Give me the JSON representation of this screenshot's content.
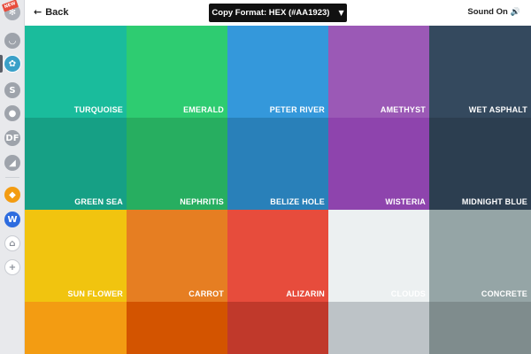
{
  "topbar": {
    "back_label": "Back",
    "back_arrow": "←",
    "copy_format_label": "Copy Format: HEX (#AA1923)",
    "copy_format_caret": "▼",
    "sound_label": "Sound On",
    "sound_icon": "🔊"
  },
  "rail": {
    "badge_text": "NEW",
    "items": [
      {
        "icon": "snowflake-icon",
        "glyph": "✻"
      },
      {
        "icon": "cup-icon",
        "glyph": "◡"
      },
      {
        "icon": "palette-icon",
        "glyph": "✿"
      },
      {
        "icon": "s-logo-icon",
        "glyph": "S"
      },
      {
        "icon": "chat-bubble-icon",
        "glyph": "●"
      },
      {
        "icon": "df-logo-icon",
        "glyph": "DF"
      },
      {
        "icon": "chart-icon",
        "glyph": "◢"
      },
      {
        "icon": "orange-app-icon",
        "glyph": "◆"
      },
      {
        "icon": "webflow-icon",
        "glyph": "W"
      },
      {
        "icon": "bank-icon",
        "glyph": "⌂"
      },
      {
        "icon": "add-icon",
        "glyph": "+"
      }
    ]
  },
  "colors": [
    {
      "name": "TURQUOISE",
      "hex": "#1abc9c"
    },
    {
      "name": "EMERALD",
      "hex": "#2ecc71"
    },
    {
      "name": "PETER RIVER",
      "hex": "#3498db"
    },
    {
      "name": "AMETHYST",
      "hex": "#9b59b6"
    },
    {
      "name": "WET ASPHALT",
      "hex": "#34495e"
    },
    {
      "name": "GREEN SEA",
      "hex": "#16a085"
    },
    {
      "name": "NEPHRITIS",
      "hex": "#27ae60"
    },
    {
      "name": "BELIZE HOLE",
      "hex": "#2980b9"
    },
    {
      "name": "WISTERIA",
      "hex": "#8e44ad"
    },
    {
      "name": "MIDNIGHT BLUE",
      "hex": "#2c3e50"
    },
    {
      "name": "SUN FLOWER",
      "hex": "#f1c40f"
    },
    {
      "name": "CARROT",
      "hex": "#e67e22"
    },
    {
      "name": "ALIZARIN",
      "hex": "#e74c3c"
    },
    {
      "name": "CLOUDS",
      "hex": "#ecf0f1"
    },
    {
      "name": "CONCRETE",
      "hex": "#95a5a6"
    },
    {
      "name": "",
      "hex": "#f39c12"
    },
    {
      "name": "",
      "hex": "#d35400"
    },
    {
      "name": "",
      "hex": "#c0392b"
    },
    {
      "name": "",
      "hex": "#bdc3c7"
    },
    {
      "name": "",
      "hex": "#7f8c8d"
    }
  ]
}
